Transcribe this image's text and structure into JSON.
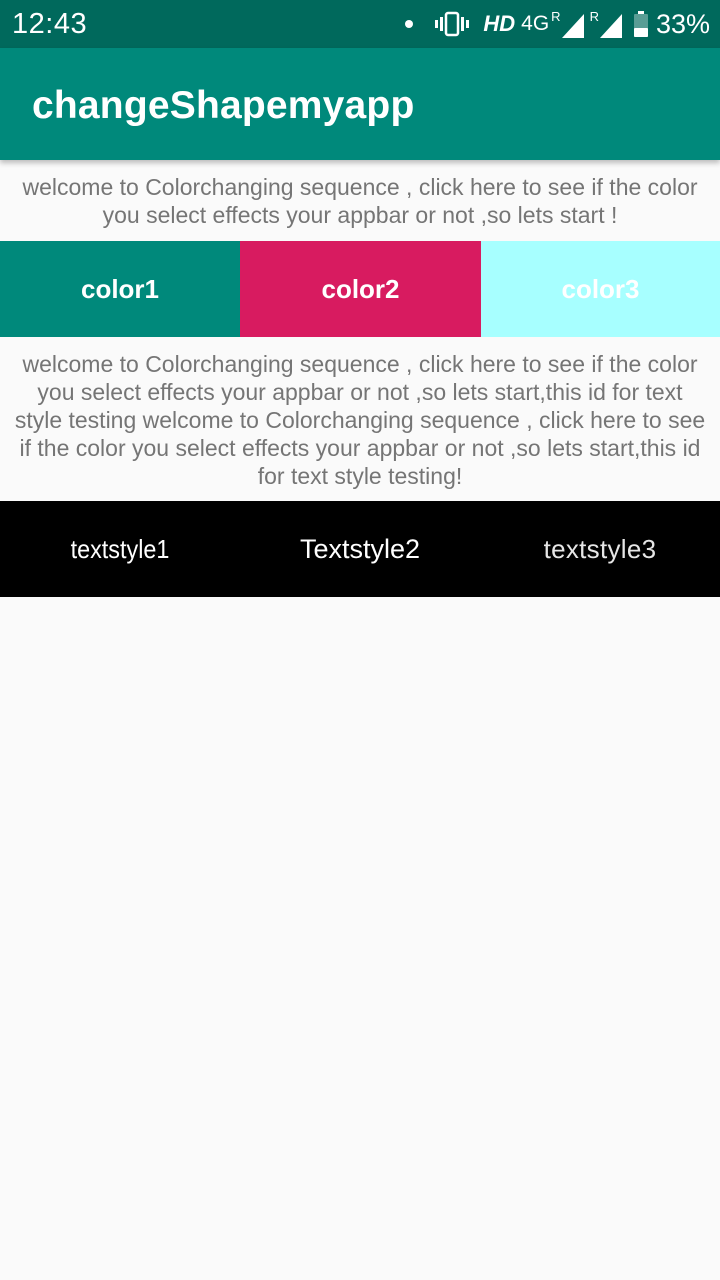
{
  "status_bar": {
    "time": "12:43",
    "network_hd": "HD",
    "network_type": "4G",
    "roaming_1": "R",
    "roaming_2": "R",
    "battery": "33%",
    "icons": [
      "notification-dot",
      "vibrate-icon",
      "signal-icon",
      "signal-icon",
      "battery-icon"
    ]
  },
  "app_bar": {
    "title": "changeShapemyapp",
    "color": "#00897b"
  },
  "intro_text": "welcome to Colorchanging sequence , click here to see if the color you select effects your appbar or not ,so lets start !",
  "color_buttons": [
    {
      "label": "color1",
      "color": "#00897b"
    },
    {
      "label": "color2",
      "color": "#d81b60"
    },
    {
      "label": "color3",
      "color": "#a7ffff"
    }
  ],
  "long_text": "welcome to Colorchanging sequence , click here to see if the color you select effects your appbar or not ,so lets start,this id for text style testing welcome to Colorchanging sequence , click here to see if the color you select effects your appbar or not ,so lets start,this id for text style testing!",
  "text_style_buttons": [
    {
      "label": "textstyle1"
    },
    {
      "label": "Textstyle2"
    },
    {
      "label": "textstyle3"
    }
  ],
  "colors": {
    "status_bar": "#00695c",
    "background": "#fafafa",
    "body_text": "#757575",
    "style_row": "#000000"
  }
}
